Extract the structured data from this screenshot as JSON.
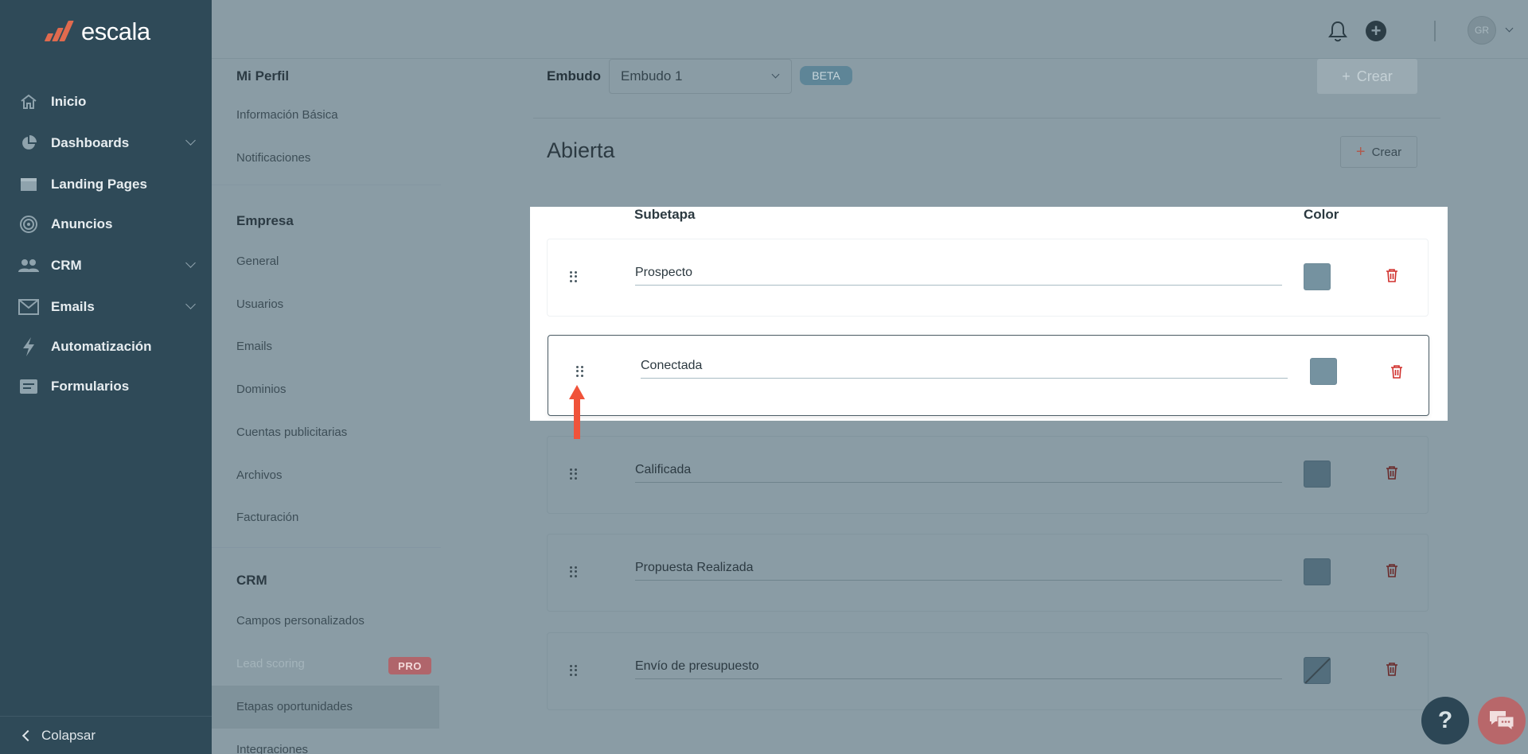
{
  "app": {
    "logo_text": "escala",
    "brand_color": "#e06a4e"
  },
  "sidebar": {
    "items": [
      {
        "label": "Inicio",
        "icon": "home-icon"
      },
      {
        "label": "Dashboards",
        "icon": "pie-chart-icon",
        "expandable": true
      },
      {
        "label": "Landing Pages",
        "icon": "browser-window-icon"
      },
      {
        "label": "Anuncios",
        "icon": "target-icon"
      },
      {
        "label": "CRM",
        "icon": "users-icon",
        "expandable": true
      },
      {
        "label": "Emails",
        "icon": "envelope-icon",
        "expandable": true
      },
      {
        "label": "Automatización",
        "icon": "lightning-icon"
      },
      {
        "label": "Formularios",
        "icon": "form-icon"
      }
    ],
    "collapse_label": "Colapsar"
  },
  "topbar": {
    "avatar_initials": "GR"
  },
  "settings_menu": {
    "mi_perfil": {
      "title": "Mi Perfil",
      "items": [
        "Información Básica",
        "Notificaciones"
      ]
    },
    "empresa": {
      "title": "Empresa",
      "items": [
        "General",
        "Usuarios",
        "Emails",
        "Dominios",
        "Cuentas publicitarias",
        "Archivos",
        "Facturación"
      ]
    },
    "crm": {
      "title": "CRM",
      "items": [
        "Campos personalizados",
        "Lead scoring",
        "Etapas oportunidades",
        "Integraciones"
      ],
      "pro_badge": "PRO",
      "active": "Etapas oportunidades"
    }
  },
  "main": {
    "embudo_label": "Embudo",
    "embudo_selected": "Embudo 1",
    "beta_badge": "BETA",
    "crear_top_label": "Crear",
    "stage_title": "Abierta",
    "crear_small_label": "Crear",
    "columns": {
      "subetapa": "Subetapa",
      "color": "Color"
    },
    "substages": [
      {
        "name": "Prospecto",
        "color": "#7592a0"
      },
      {
        "name": "Conectada",
        "color": "#7592a0"
      },
      {
        "name": "Calificada",
        "color": "#536e7d"
      },
      {
        "name": "Propuesta Realizada",
        "color": "#536e7d"
      },
      {
        "name": "Envío de presupuesto",
        "color": "none"
      }
    ]
  },
  "floating": {
    "help_label": "?"
  }
}
